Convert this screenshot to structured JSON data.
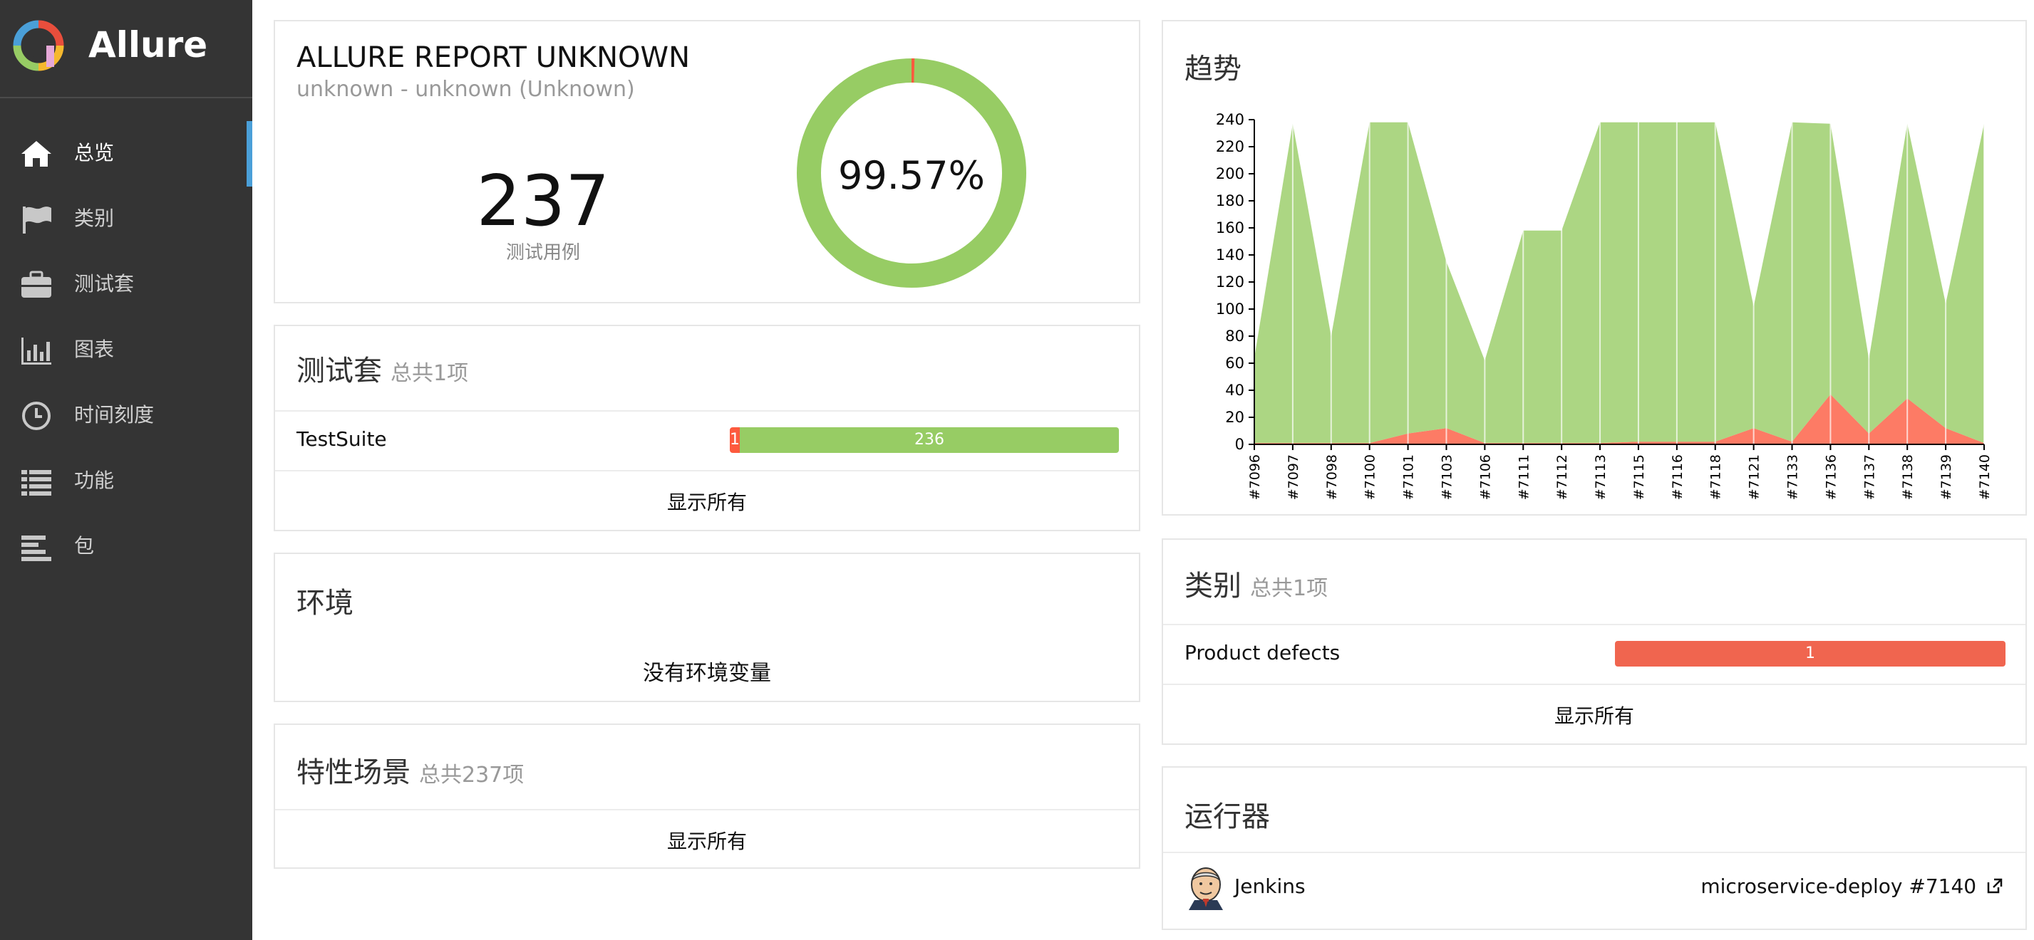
{
  "brand": {
    "name": "Allure"
  },
  "sidebar": {
    "items": [
      {
        "label": "总览",
        "icon": "home-icon",
        "active": true
      },
      {
        "label": "类别",
        "icon": "flag-icon",
        "active": false
      },
      {
        "label": "测试套",
        "icon": "briefcase-icon",
        "active": false
      },
      {
        "label": "图表",
        "icon": "bar-chart-icon",
        "active": false
      },
      {
        "label": "时间刻度",
        "icon": "clock-icon",
        "active": false
      },
      {
        "label": "功能",
        "icon": "list-icon",
        "active": false
      },
      {
        "label": "包",
        "icon": "align-left-icon",
        "active": false
      }
    ]
  },
  "summary": {
    "title": "ALLURE REPORT UNKNOWN",
    "subtitle": "unknown - unknown (Unknown)",
    "case_count": "237",
    "case_label": "测试用例",
    "pass_rate": "99.57%",
    "passed": 236,
    "failed": 1
  },
  "suites": {
    "title": "测试套",
    "sub": "总共1项",
    "rows": [
      {
        "name": "TestSuite",
        "failed": 1,
        "passed": 236
      }
    ],
    "show_all": "显示所有"
  },
  "environment": {
    "title": "环境",
    "empty_text": "没有环境变量"
  },
  "features": {
    "title": "特性场景",
    "sub": "总共237项",
    "show_all": "显示所有"
  },
  "trend": {
    "title": "趋势"
  },
  "categories": {
    "title": "类别",
    "sub": "总共1项",
    "rows": [
      {
        "name": "Product defects",
        "count": 1
      }
    ],
    "show_all": "显示所有"
  },
  "executors": {
    "title": "运行器",
    "name": "Jenkins",
    "build": "microservice-deploy #7140",
    "icon": "external-link-icon"
  },
  "colors": {
    "passed": "#97cc64",
    "failed": "#fd5a3e",
    "broken": "#ffd050",
    "sidebar": "#343434",
    "accent": "#4a9fd8"
  },
  "chart_data": {
    "type": "area",
    "title": "",
    "xlabel": "",
    "ylabel": "",
    "ylim": [
      0,
      240
    ],
    "yticks": [
      0,
      20,
      40,
      60,
      80,
      100,
      120,
      140,
      160,
      180,
      200,
      220,
      240
    ],
    "categories": [
      "#7096",
      "#7097",
      "#7098",
      "#7100",
      "#7101",
      "#7103",
      "#7106",
      "#7111",
      "#7112",
      "#7113",
      "#7115",
      "#7116",
      "#7118",
      "#7121",
      "#7133",
      "#7136",
      "#7137",
      "#7138",
      "#7139",
      "#7140"
    ],
    "series": [
      {
        "name": "failed",
        "color": "#fd5a3e",
        "values": [
          1,
          1,
          1,
          1,
          8,
          12,
          1,
          1,
          1,
          1,
          2,
          2,
          2,
          12,
          2,
          37,
          8,
          34,
          12,
          1
        ]
      },
      {
        "name": "passed",
        "color": "#97cc64",
        "values": [
          63,
          236,
          79,
          237,
          230,
          123,
          61,
          157,
          157,
          237,
          236,
          236,
          236,
          90,
          236,
          200,
          55,
          203,
          92,
          236
        ]
      }
    ]
  }
}
